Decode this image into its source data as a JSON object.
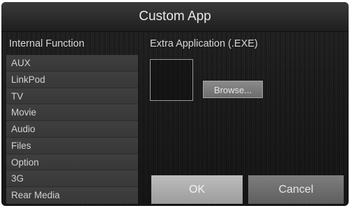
{
  "window": {
    "title": "Custom App"
  },
  "internal": {
    "heading": "Internal Function",
    "items": [
      {
        "label": "AUX"
      },
      {
        "label": "LinkPod"
      },
      {
        "label": "TV"
      },
      {
        "label": "Movie"
      },
      {
        "label": "Audio"
      },
      {
        "label": "Files"
      },
      {
        "label": "Option"
      },
      {
        "label": "3G"
      },
      {
        "label": "Rear Media"
      }
    ]
  },
  "extra": {
    "heading": "Extra Application (.EXE)",
    "browse_label": "Browse..."
  },
  "actions": {
    "ok_label": "OK",
    "cancel_label": "Cancel"
  }
}
